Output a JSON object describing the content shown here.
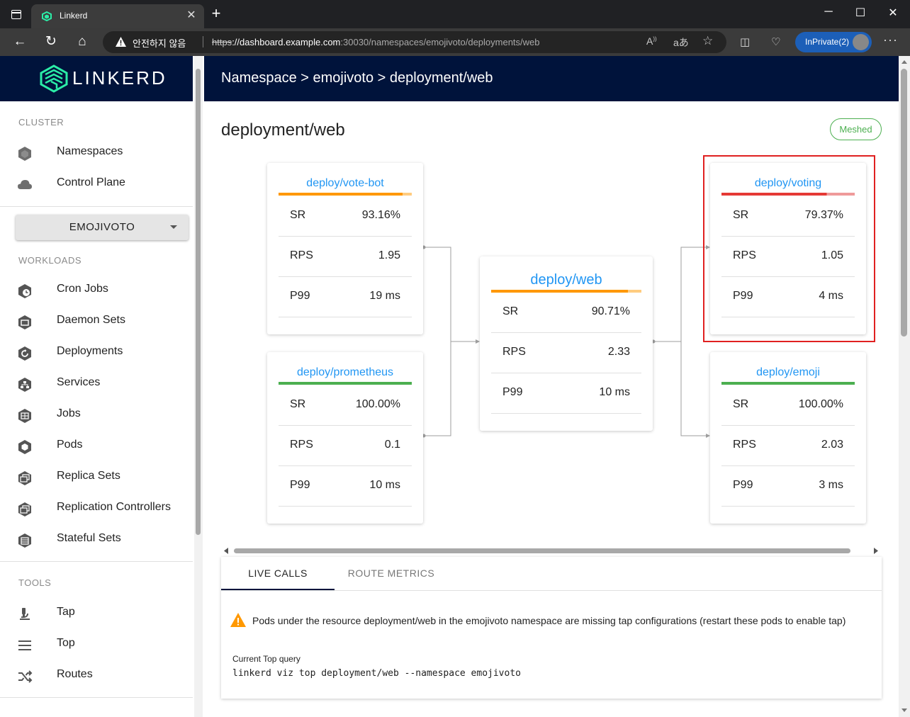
{
  "browser": {
    "tab_title": "Linkerd",
    "tab_close": "✕",
    "new_tab": "+",
    "insecure_label": "안전하지 않음",
    "url_scheme": "https",
    "url_host": "://dashboard.example.com",
    "url_rest": ":30030/namespaces/emojivoto/deployments/web",
    "inprivate_label": "InPrivate(2)",
    "more": "···"
  },
  "sidebar": {
    "logo_text": "LINKERD",
    "cluster_title": "CLUSTER",
    "cluster_items": [
      {
        "label": "Namespaces",
        "icon": "namespace-icon"
      },
      {
        "label": "Control Plane",
        "icon": "cloud-icon"
      }
    ],
    "namespace_select": "EMOJIVOTO",
    "workloads_title": "WORKLOADS",
    "workload_items": [
      {
        "label": "Cron Jobs"
      },
      {
        "label": "Daemon Sets"
      },
      {
        "label": "Deployments"
      },
      {
        "label": "Services"
      },
      {
        "label": "Jobs"
      },
      {
        "label": "Pods"
      },
      {
        "label": "Replica Sets"
      },
      {
        "label": "Replication Controllers"
      },
      {
        "label": "Stateful Sets"
      }
    ],
    "tools_title": "TOOLS",
    "tool_items": [
      {
        "label": "Tap",
        "icon": "microscope-icon"
      },
      {
        "label": "Top",
        "icon": "list-icon"
      },
      {
        "label": "Routes",
        "icon": "shuffle-icon"
      }
    ]
  },
  "header": {
    "breadcrumb": "Namespace > emojivoto > deployment/web"
  },
  "main": {
    "title": "deployment/web",
    "status_badge": "Meshed",
    "cards": {
      "vote_bot": {
        "title": "deploy/vote-bot",
        "bar_color": "#ff9800",
        "sr": "93.16%",
        "rps": "1.95",
        "p99": "19 ms"
      },
      "prometheus": {
        "title": "deploy/prometheus",
        "bar_color": "#4caf50",
        "sr": "100.00%",
        "rps": "0.1",
        "p99": "10 ms"
      },
      "web": {
        "title": "deploy/web",
        "bar_color": "#ff9800",
        "sr": "90.71%",
        "rps": "2.33",
        "p99": "10 ms"
      },
      "voting": {
        "title": "deploy/voting",
        "bar_color": "#e53935",
        "sr": "79.37%",
        "rps": "1.05",
        "p99": "4 ms"
      },
      "emoji": {
        "title": "deploy/emoji",
        "bar_color": "#4caf50",
        "sr": "100.00%",
        "rps": "2.03",
        "p99": "3 ms"
      }
    },
    "row_labels": {
      "sr": "SR",
      "rps": "RPS",
      "p99": "P99"
    },
    "tabs": [
      {
        "label": "LIVE CALLS",
        "active": true
      },
      {
        "label": "ROUTE METRICS",
        "active": false
      }
    ],
    "alert_text": "Pods under the resource deployment/web in the emojivoto namespace are missing tap configurations (restart these pods to enable tap)",
    "query_label": "Current Top query",
    "query_command": "linkerd viz top deployment/web --namespace emojivoto"
  },
  "colors": {
    "navy": "#00133b",
    "link_blue": "#2196f3",
    "success_green": "#4caf50",
    "warning_orange": "#ff9800",
    "error_red": "#e53935",
    "highlight_red": "#e02020"
  }
}
